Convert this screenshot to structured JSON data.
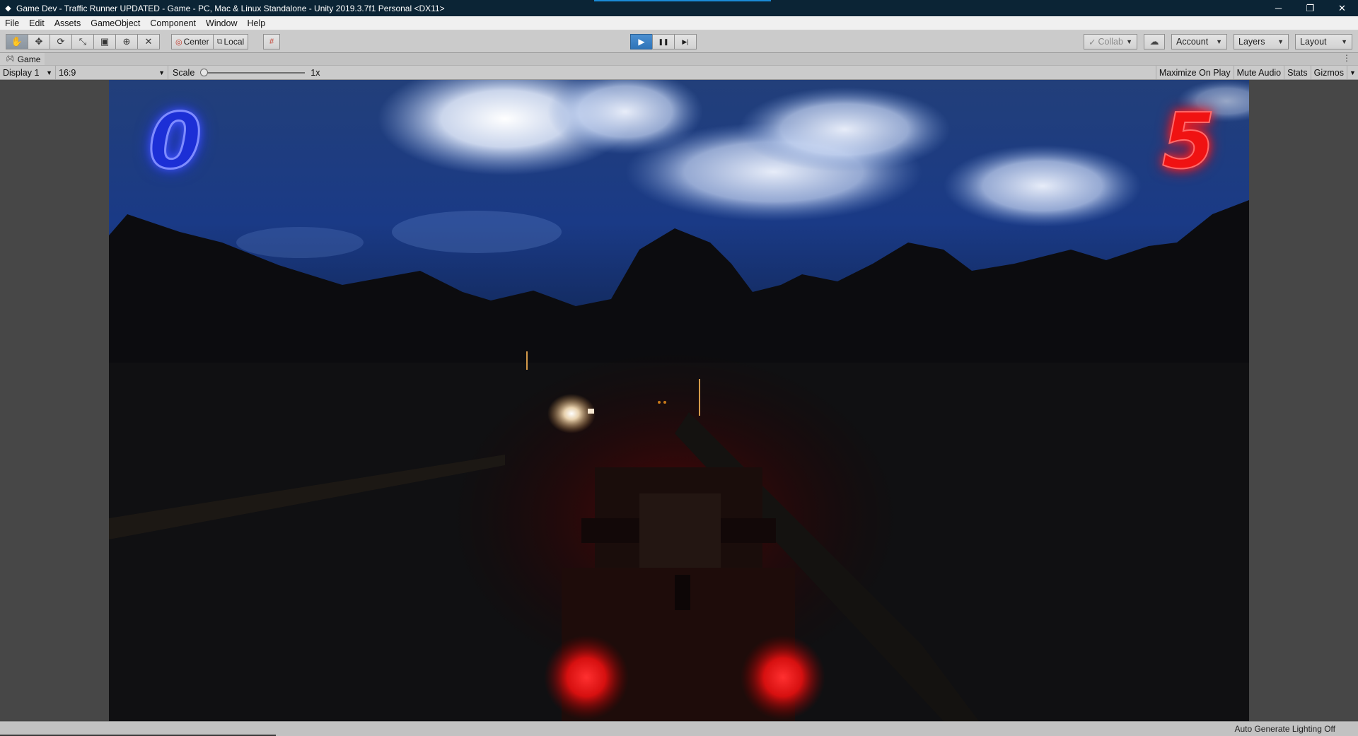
{
  "window": {
    "title": "Game Dev - Traffic Runner UPDATED - Game - PC, Mac & Linux Standalone - Unity 2019.3.7f1 Personal <DX11>",
    "app_icon": "unity-icon",
    "controls": {
      "minimize": "─",
      "restore": "❐",
      "close": "✕"
    }
  },
  "menu": [
    "File",
    "Edit",
    "Assets",
    "GameObject",
    "Component",
    "Window",
    "Help"
  ],
  "toolbar": {
    "tools": [
      "hand-tool-icon",
      "move-tool-icon",
      "rotate-tool-icon",
      "scale-tool-icon",
      "rect-tool-icon",
      "transform-tool-icon",
      "custom-tool-icon"
    ],
    "pivot_mode": "Center",
    "pivot_rotation": "Local",
    "play": "▶",
    "pause": "❚❚",
    "step": "▶|",
    "collab": "Collab",
    "account": "Account",
    "layers": "Layers",
    "layout": "Layout"
  },
  "game_view": {
    "tab_label": "Game",
    "display": "Display 1",
    "aspect": "16:9",
    "scale_label": "Scale",
    "scale_value": "1x",
    "scale_fraction": 0.0,
    "toggles": [
      "Maximize On Play",
      "Mute Audio",
      "Stats",
      "Gizmos"
    ],
    "score_left": "0",
    "score_right": "5"
  },
  "status": {
    "text": "Auto Generate Lighting Off"
  },
  "colors": {
    "play_active": "#2f74b8",
    "score_left": "#1c2fd6",
    "score_right": "#f01212",
    "title_bar": "#0b2435"
  }
}
